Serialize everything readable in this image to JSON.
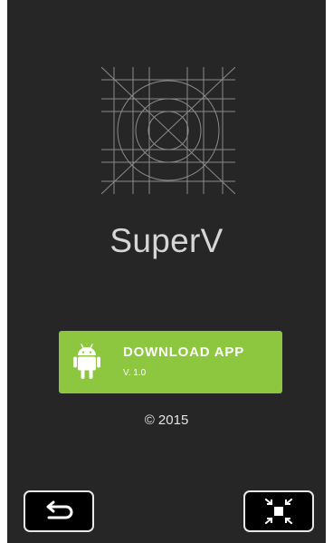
{
  "app": {
    "title": "SuperV",
    "logo_icon": "grid-circle-logo-icon"
  },
  "download": {
    "label": "DOWNLOAD APP",
    "version": "V. 1.0",
    "icon": "android-icon",
    "color": "#8dc63f"
  },
  "footer": {
    "copyright": "© 2015"
  },
  "nav": {
    "back_icon": "back-arrow-icon",
    "collapse_icon": "collapse-fullscreen-icon"
  },
  "colors": {
    "background": "#262626",
    "text": "#d6d6d6",
    "nav_button": "#000000"
  }
}
